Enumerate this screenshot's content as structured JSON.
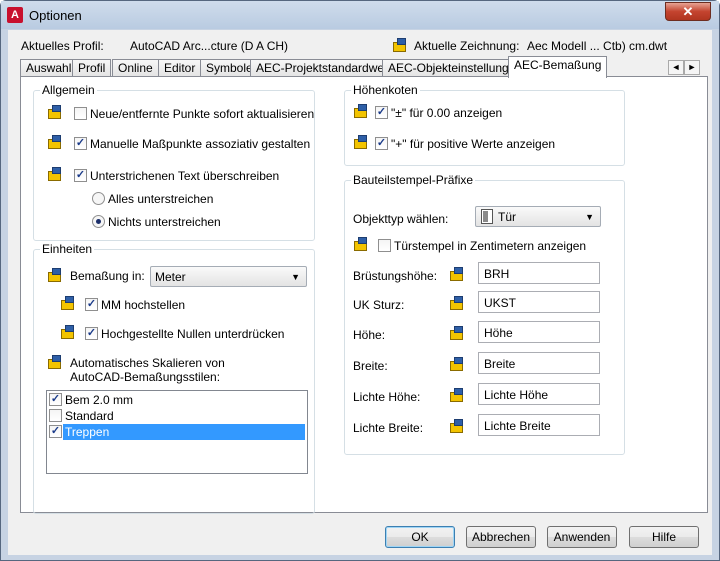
{
  "window": {
    "title": "Optionen",
    "close": "✕"
  },
  "profile": {
    "label": "Aktuelles Profil:",
    "value": "AutoCAD Arc...cture (D A CH)",
    "drawing_label": "Aktuelle Zeichnung:",
    "drawing_value": "Aec Modell ... Ctb) cm.dwt"
  },
  "tabs": [
    "Auswahl",
    "Profil",
    "Online",
    "Editor",
    "Symbole",
    "AEC-Projektstandardwerte",
    "AEC-Objekteinstellungen",
    "AEC-Bemaßung"
  ],
  "tab_scroll": {
    "left": "◄",
    "right": "►"
  },
  "allgemein": {
    "title": "Allgemein",
    "opt1": "Neue/entfernte Punkte sofort aktualisieren",
    "opt1_checked": false,
    "opt2": "Manuelle Maßpunkte assoziativ gestalten",
    "opt2_checked": true,
    "opt3": "Unterstrichenen Text überschreiben",
    "opt3_checked": true,
    "radio1": "Alles unterstreichen",
    "radio2": "Nichts unterstreichen",
    "radio_selected": "radio2"
  },
  "einheiten": {
    "title": "Einheiten",
    "bemassung_label": "Bemaßung in:",
    "bemassung_value": "Meter",
    "mm": "MM hochstellen",
    "mm_checked": true,
    "nullen": "Hochgestellte Nullen unterdrücken",
    "nullen_checked": true,
    "auto_scale": "Automatisches Skalieren von AutoCAD-Bemaßungsstilen:",
    "styles": [
      {
        "name": "Bem 2.0 mm",
        "checked": true,
        "selected": false
      },
      {
        "name": "Standard",
        "checked": false,
        "selected": false
      },
      {
        "name": "Treppen",
        "checked": true,
        "selected": true
      }
    ]
  },
  "hoehenkoten": {
    "title": "Höhenkoten",
    "opt1": "\"±\" für 0.00 anzeigen",
    "opt1_checked": true,
    "opt2": "\"+\" für positive Werte anzeigen",
    "opt2_checked": true
  },
  "bauteil": {
    "title": "Bauteilstempel-Präfixe",
    "objekttyp_label": "Objekttyp wählen:",
    "objekttyp_value": "Tür",
    "zentimeter": "Türstempel in Zentimetern anzeigen",
    "zentimeter_checked": false,
    "fields": [
      {
        "label": "Brüstungshöhe:",
        "value": "BRH"
      },
      {
        "label": "UK Sturz:",
        "value": "UKST"
      },
      {
        "label": "Höhe:",
        "value": "Höhe"
      },
      {
        "label": "Breite:",
        "value": "Breite"
      },
      {
        "label": "Lichte Höhe:",
        "value": "Lichte Höhe"
      },
      {
        "label": "Lichte Breite:",
        "value": "Lichte Breite"
      }
    ]
  },
  "buttons": {
    "ok": "OK",
    "cancel": "Abbrechen",
    "apply": "Anwenden",
    "help": "Hilfe"
  },
  "icons": {
    "app": "autocad-logo-icon",
    "setting": "drawing-setting-icon",
    "door": "door-icon",
    "dropdown": "chevron-down-icon"
  },
  "colors": {
    "selection": "#3399ff",
    "close": "#c4442f",
    "icon_yellow": "#f3c400",
    "icon_blue": "#2e5fa7"
  }
}
